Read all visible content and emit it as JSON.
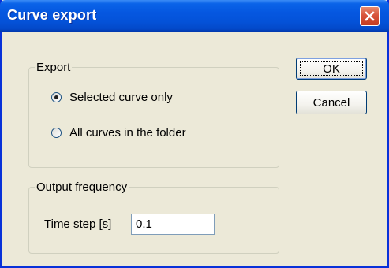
{
  "window": {
    "title": "Curve export",
    "close_icon": "close-icon"
  },
  "export_group": {
    "legend": "Export",
    "options": [
      {
        "label": "Selected curve only",
        "checked": true
      },
      {
        "label": "All curves in the folder",
        "checked": false
      }
    ]
  },
  "output_group": {
    "legend": "Output frequency",
    "time_step_label": "Time step [s]",
    "time_step_value": "0.1"
  },
  "buttons": {
    "ok": "OK",
    "cancel": "Cancel"
  }
}
